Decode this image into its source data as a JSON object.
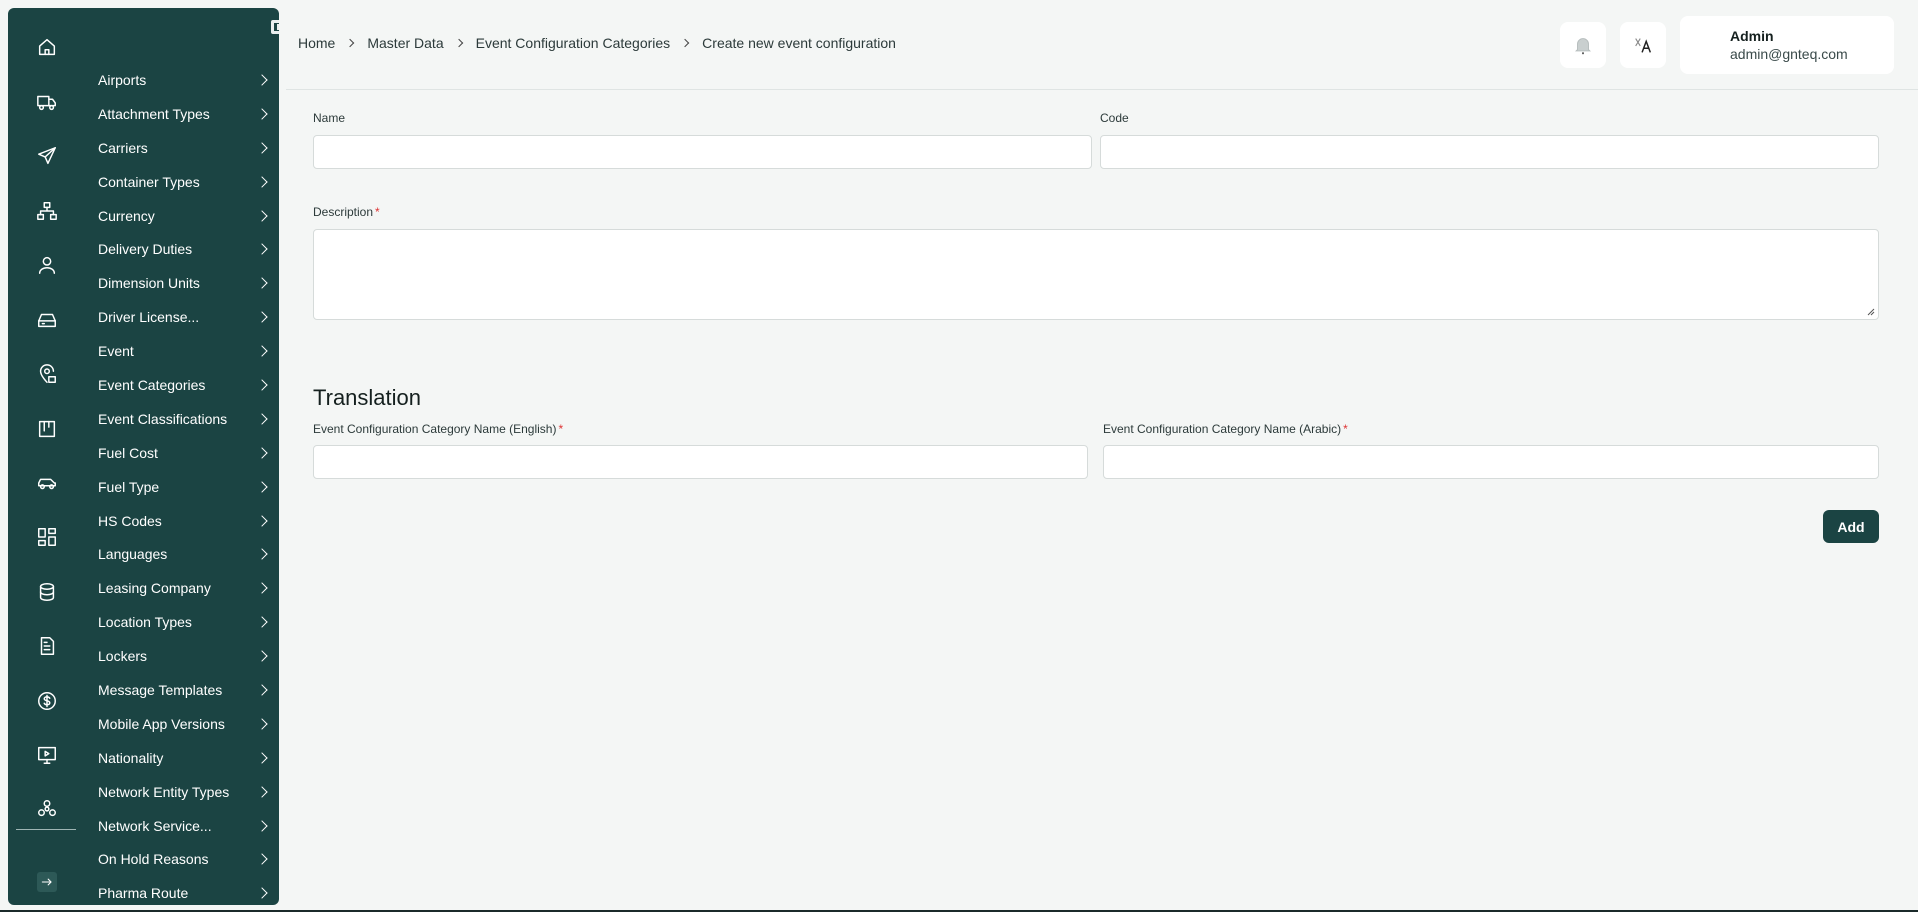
{
  "sidebar": {
    "rail_icons": [
      "home-icon",
      "truck-icon",
      "plane-icon",
      "hierarchy-icon",
      "user-icon",
      "inbox-icon",
      "map-pin-icon",
      "kanban-icon",
      "car-icon",
      "dashboard-icon",
      "database-icon",
      "document-icon",
      "dollar-icon",
      "monitor-icon",
      "network-icon"
    ],
    "items": [
      {
        "label": "Airports"
      },
      {
        "label": "Attachment Types"
      },
      {
        "label": "Carriers"
      },
      {
        "label": "Container Types"
      },
      {
        "label": "Currency"
      },
      {
        "label": "Delivery Duties"
      },
      {
        "label": "Dimension Units"
      },
      {
        "label": "Driver License..."
      },
      {
        "label": "Event"
      },
      {
        "label": "Event Categories"
      },
      {
        "label": "Event Classifications"
      },
      {
        "label": "Fuel Cost"
      },
      {
        "label": "Fuel Type"
      },
      {
        "label": "HS Codes"
      },
      {
        "label": "Languages"
      },
      {
        "label": "Leasing Company"
      },
      {
        "label": "Location Types"
      },
      {
        "label": "Lockers"
      },
      {
        "label": "Message Templates"
      },
      {
        "label": "Mobile App Versions"
      },
      {
        "label": "Nationality"
      },
      {
        "label": "Network Entity Types"
      },
      {
        "label": "Network Service..."
      },
      {
        "label": "On Hold Reasons"
      },
      {
        "label": "Pharma Route"
      }
    ]
  },
  "header": {
    "breadcrumb": [
      "Home",
      "Master Data",
      "Event Configuration Categories",
      "Create new event configuration"
    ],
    "user": {
      "name": "Admin",
      "email": "admin@gnteq.com"
    }
  },
  "form": {
    "name_label": "Name",
    "name_value": "",
    "code_label": "Code",
    "code_value": "",
    "description_label": "Description",
    "description_value": "",
    "translation_title": "Translation",
    "en_label": "Event Configuration Category Name  (English)",
    "en_value": "",
    "ar_label": "Event Configuration Category Name  (Arabic)",
    "ar_value": "",
    "required_mark": "*",
    "add_label": "Add"
  },
  "colors": {
    "sidebar_bg": "#1b4443",
    "accent": "#1b4443",
    "required": "#dd3333"
  }
}
